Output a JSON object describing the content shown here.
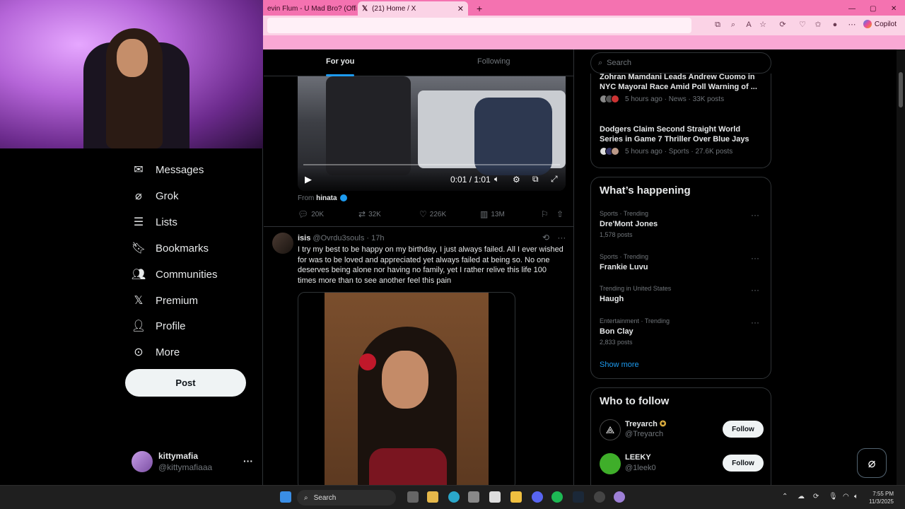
{
  "browser": {
    "tabs": [
      {
        "title": "evin Flum - U Mad Bro? (Officia",
        "active": false
      },
      {
        "title": "(21) Home / X",
        "active": true
      }
    ],
    "new_tab": "+",
    "copilot_label": "Copilot"
  },
  "sidebar": {
    "items": [
      {
        "label": "Messages",
        "icon": "envelope-icon"
      },
      {
        "label": "Grok",
        "icon": "grok-icon"
      },
      {
        "label": "Lists",
        "icon": "list-icon"
      },
      {
        "label": "Bookmarks",
        "icon": "bookmark-icon"
      },
      {
        "label": "Communities",
        "icon": "people-icon"
      },
      {
        "label": "Premium",
        "icon": "x-logo-icon"
      },
      {
        "label": "Profile",
        "icon": "person-icon"
      },
      {
        "label": "More",
        "icon": "more-circle-icon"
      }
    ],
    "post_label": "Post",
    "account": {
      "name": "kittymafia",
      "handle": "@kittymafiaaa"
    }
  },
  "feed": {
    "tabs": [
      {
        "label": "For you",
        "active": true
      },
      {
        "label": "Following",
        "active": false
      }
    ],
    "tweet1": {
      "video_time": "0:01 / 1:01",
      "from_label": "From",
      "from_name": "hinata",
      "replies": "20K",
      "retweets": "32K",
      "likes": "226K",
      "views": "13M"
    },
    "tweet2": {
      "name": "isis",
      "handle": "@Ovrdu3souls",
      "time": "· 17h",
      "text": "I try my best to be happy on my birthday, I just always failed. All I ever wished for was to be loved and appreciated yet always failed at being so. No one deserves being alone nor having no family, yet I rather relive this life 100 times more than to see another feel this pain"
    }
  },
  "right": {
    "search_placeholder": "Search",
    "news": [
      {
        "title": "Zohran Mamdani Leads Andrew Cuomo in NYC Mayoral Race Amid Poll Warning of ...",
        "meta": "5 hours ago · News · 33K posts"
      },
      {
        "title": "Dodgers Claim Second Straight World Series in Game 7 Thriller Over Blue Jays",
        "meta": "5 hours ago · Sports · 27.6K posts"
      }
    ],
    "happening_title": "What’s happening",
    "trends": [
      {
        "context": "Sports · Trending",
        "name": "Dre'Mont Jones",
        "count": "1,578 posts"
      },
      {
        "context": "Sports · Trending",
        "name": "Frankie Luvu",
        "count": ""
      },
      {
        "context": "Trending in United States",
        "name": "Haugh",
        "count": ""
      },
      {
        "context": "Entertainment · Trending",
        "name": "Bon Clay",
        "count": "2,833 posts"
      }
    ],
    "show_more": "Show more",
    "who_title": "Who to follow",
    "follow": [
      {
        "name": "Treyarch",
        "handle": "@Treyarch",
        "button": "Follow"
      },
      {
        "name": "LEEKY",
        "handle": "@1leek0",
        "button": "Follow"
      }
    ]
  },
  "taskbar": {
    "search_label": "Search",
    "time": "7:55 PM",
    "date": "11/3/2025"
  },
  "colors": {
    "accent": "#1d9bf0",
    "tab_bar": "#f472b0",
    "background": "#000000"
  }
}
